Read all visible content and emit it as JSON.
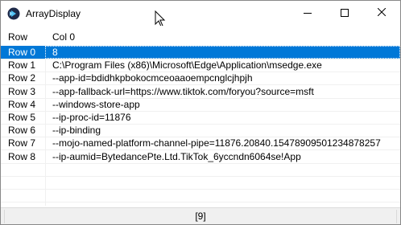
{
  "window": {
    "title": "ArrayDisplay",
    "icon": "arraydisplay-app-icon",
    "controls": [
      "minimize-icon",
      "maximize-icon",
      "close-icon"
    ]
  },
  "grid": {
    "headers": [
      "Row",
      "Col 0"
    ],
    "rows": [
      {
        "label": "Row 0",
        "value": "8",
        "selected": true
      },
      {
        "label": "Row 1",
        "value": "C:\\Program Files (x86)\\Microsoft\\Edge\\Application\\msedge.exe",
        "selected": false
      },
      {
        "label": "Row 2",
        "value": "--app-id=bdidhkpbokocmceoaaoempcnglcjhpjh",
        "selected": false
      },
      {
        "label": "Row 3",
        "value": "--app-fallback-url=https://www.tiktok.com/foryou?source=msft",
        "selected": false
      },
      {
        "label": "Row 4",
        "value": "--windows-store-app",
        "selected": false
      },
      {
        "label": "Row 5",
        "value": "--ip-proc-id=11876",
        "selected": false
      },
      {
        "label": "Row 6",
        "value": "--ip-binding",
        "selected": false
      },
      {
        "label": "Row 7",
        "value": "--mojo-named-platform-channel-pipe=11876.20840.15478909501234878257",
        "selected": false
      },
      {
        "label": "Row 8",
        "value": "--ip-aumid=BytedancePte.Ltd.TikTok_6yccndn6064se!App",
        "selected": false
      }
    ]
  },
  "status": {
    "text": "[9]"
  },
  "colors": {
    "selection": "#0078d7",
    "grid_line": "#f0f0f0",
    "status_bg": "#f0f0f0"
  }
}
